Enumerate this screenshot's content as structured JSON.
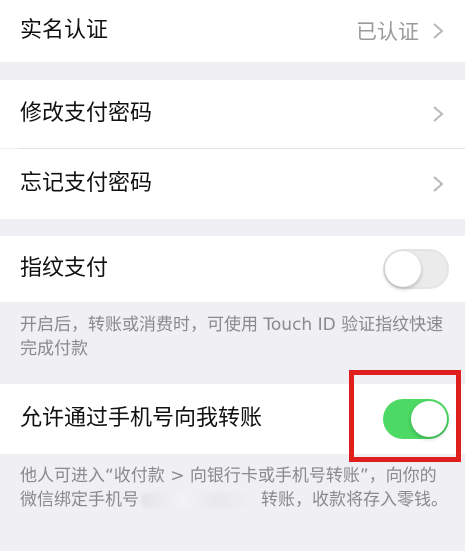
{
  "real_name": {
    "label": "实名认证",
    "status": "已认证"
  },
  "change_password": {
    "label": "修改支付密码"
  },
  "forgot_password": {
    "label": "忘记支付密码"
  },
  "fingerprint": {
    "label": "指纹支付",
    "enabled": false,
    "description": "开启后，转账或消费时，可使用 Touch ID 验证指纹快速完成付款"
  },
  "phone_transfer": {
    "label": "允许通过手机号向我转账",
    "enabled": true,
    "description_before": "他人可进入“收付款 > 向银行卡或手机号转账”，向你的微信绑定手机号",
    "description_after": "转账，收款将存入零钱。"
  },
  "colors": {
    "toggle_on": "#4cd964",
    "highlight": "#e01e1e",
    "background": "#efeff4"
  }
}
